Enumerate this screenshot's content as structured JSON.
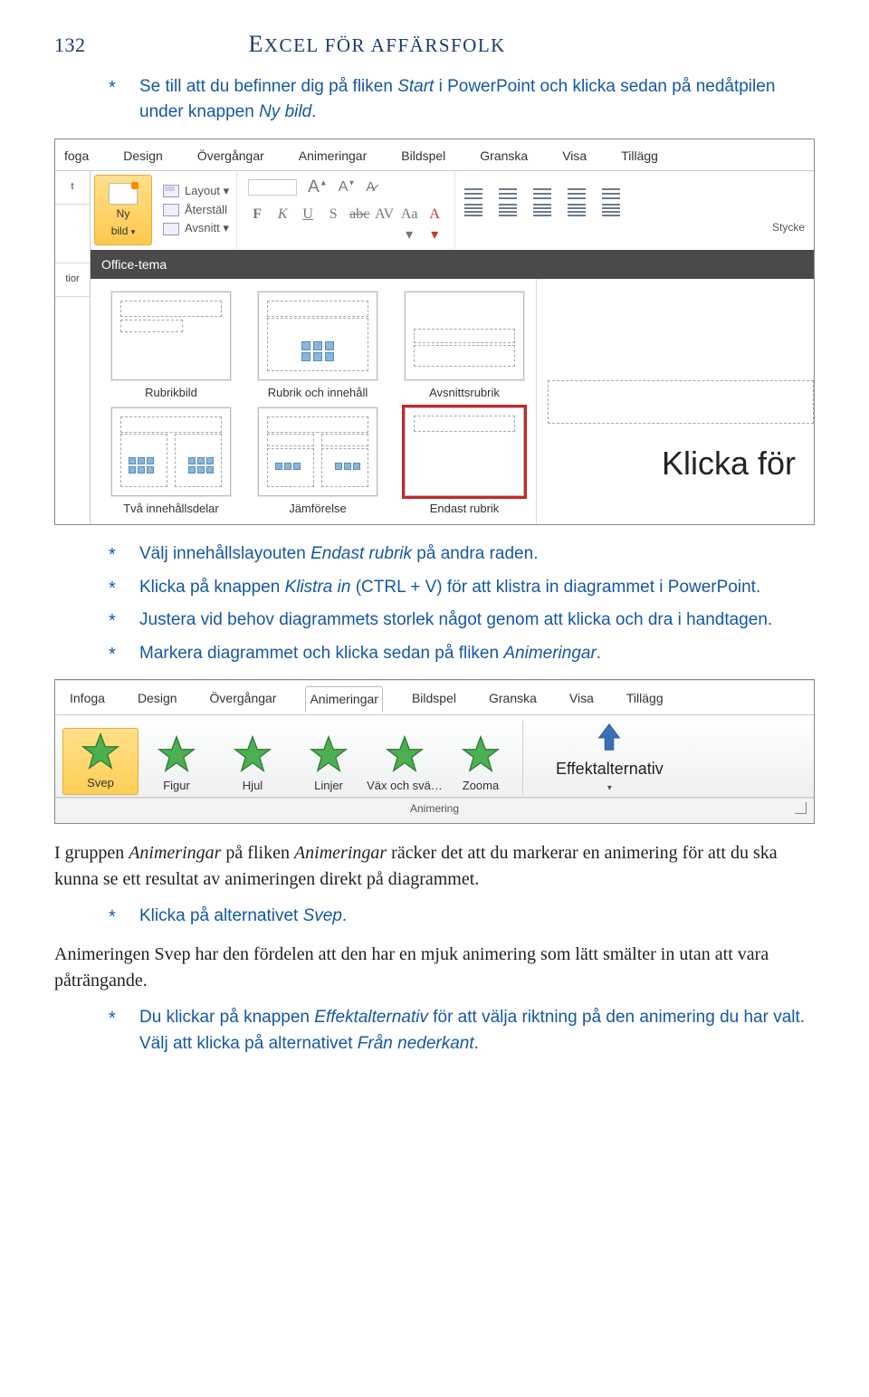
{
  "page": {
    "number": "132",
    "book_title": "Excel för affärsfolk"
  },
  "intro": {
    "line1_a": "Se till att du befinner dig på fliken ",
    "line1_b": "Start",
    "line1_c": " i PowerPoint och klicka sedan på nedåtpilen under knappen ",
    "line1_d": "Ny bild",
    "line1_e": "."
  },
  "shot1": {
    "tabs": [
      "foga",
      "Design",
      "Övergångar",
      "Animeringar",
      "Bildspel",
      "Granska",
      "Visa",
      "Tillägg"
    ],
    "leftcol": [
      "t",
      "tior"
    ],
    "nybild": {
      "l1": "Ny",
      "l2": "bild",
      "arrow": "▾"
    },
    "mid": {
      "layout": "Layout ▾",
      "aterstall": "Återställ",
      "avsnitt": "Avsnitt ▾"
    },
    "font_letters": {
      "F": "F",
      "K": "K",
      "U": "U",
      "S": "S",
      "abc": "abc",
      "AV": "AV",
      "Aa": "Aa ▾",
      "A": "A ▾"
    },
    "stycke": "Stycke",
    "office": "Office-tema",
    "layouts": {
      "l1": "Rubrikbild",
      "l2": "Rubrik och innehåll",
      "l3": "Avsnittsrubrik",
      "l4": "Två innehållsdelar",
      "l5": "Jämförelse",
      "l6": "Endast rubrik"
    },
    "preview_text": "Klicka för"
  },
  "after1": {
    "b1_a": "Välj innehållslayouten ",
    "b1_b": "Endast rubrik",
    "b1_c": " på andra raden.",
    "b2_a": "Klicka på knappen ",
    "b2_b": "Klistra in",
    "b2_c": " (CTRL + V) för att klistra in diagrammet i PowerPoint.",
    "b3": "Justera vid behov diagrammets storlek något genom att klicka och dra i handtagen.",
    "b4_a": "Markera diagrammet och klicka sedan på fliken ",
    "b4_b": "Animeringar",
    "b4_c": "."
  },
  "shot2": {
    "tabs": [
      "Infoga",
      "Design",
      "Övergångar",
      "Animeringar",
      "Bildspel",
      "Granska",
      "Visa",
      "Tillägg"
    ],
    "active_tab_index": 3,
    "items": [
      "Svep",
      "Figur",
      "Hjul",
      "Linjer",
      "Väx och svä…",
      "Zooma"
    ],
    "effekt": "Effektalternativ",
    "group_label": "Animering"
  },
  "after2": {
    "p1_a": "I gruppen ",
    "p1_b": "Animeringar",
    "p1_c": " på fliken ",
    "p1_d": "Animeringar",
    "p1_e": " räcker det att du markerar en animering för att du ska kunna se ett resultat av animeringen direkt på diagrammet.",
    "b1_a": "Klicka på alternativet ",
    "b1_b": "Svep",
    "b1_c": ".",
    "p2": "Animeringen Svep har den fördelen att den har en mjuk animering som lätt smälter in utan att vara påträngande.",
    "b2_a": "Du klickar på knappen ",
    "b2_b": "Effektalternativ",
    "b2_c": " för att välja riktning på den animering du har valt. Välj att klicka på alternativet ",
    "b2_d": "Från nederkant",
    "b2_e": "."
  }
}
